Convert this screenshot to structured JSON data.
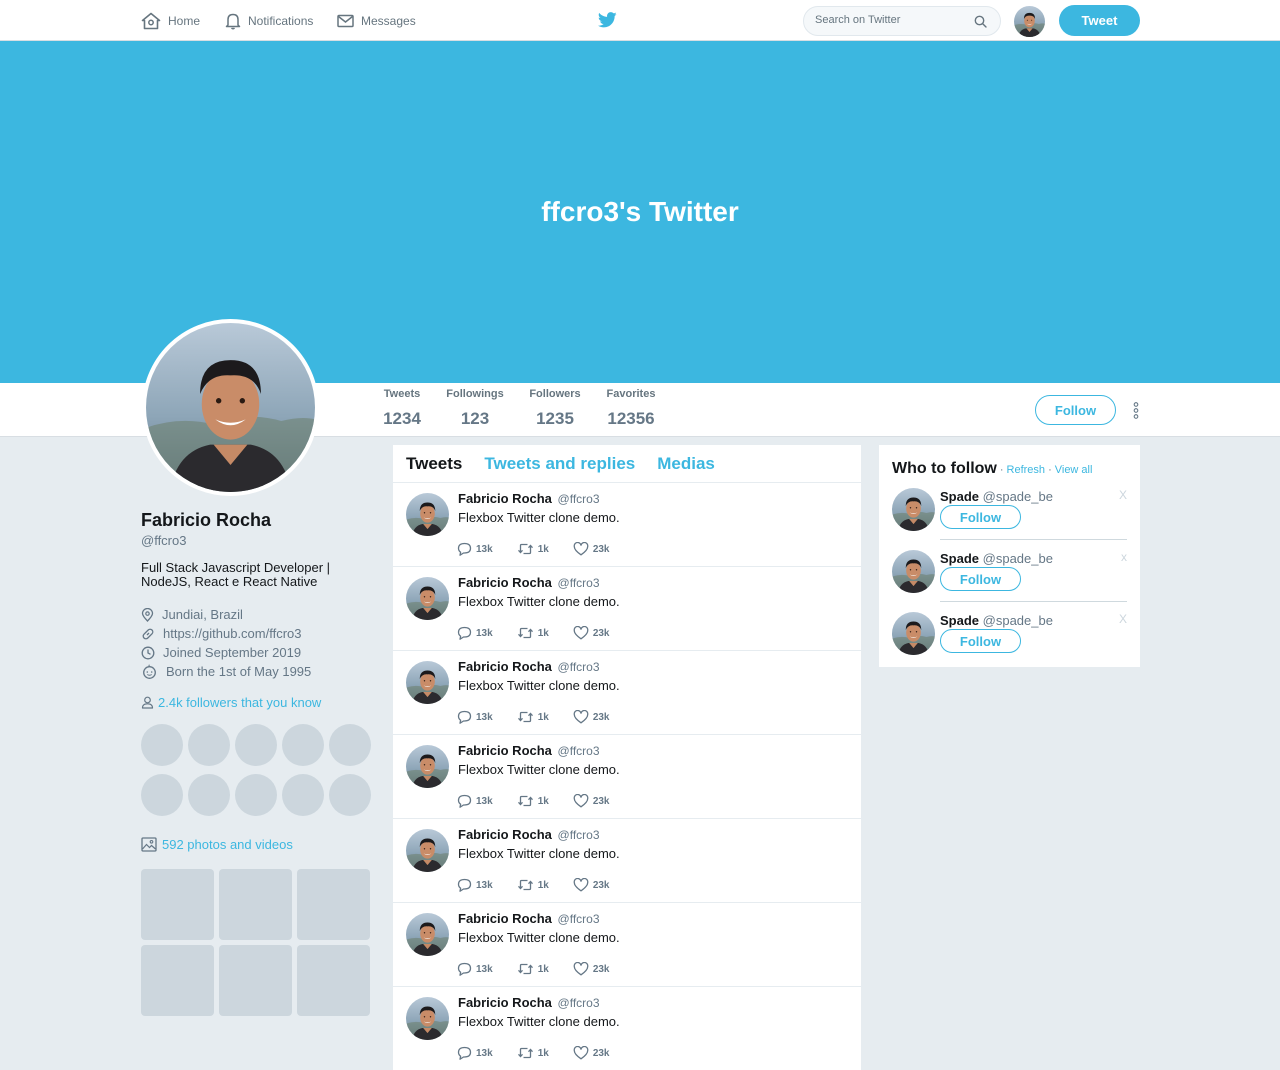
{
  "nav": {
    "items": [
      {
        "label": "Home",
        "icon": "home-icon"
      },
      {
        "label": "Notifications",
        "icon": "bell-icon"
      },
      {
        "label": "Messages",
        "icon": "envelope-icon"
      }
    ],
    "logo_icon": "twitter-bird-icon",
    "search_placeholder": "Search on Twitter",
    "tweet_button": "Tweet"
  },
  "banner": {
    "title": "ffcro3's Twitter"
  },
  "stats": [
    {
      "label": "Tweets",
      "value": "1234"
    },
    {
      "label": "Followings",
      "value": "123"
    },
    {
      "label": "Followers",
      "value": "1235"
    },
    {
      "label": "Favorites",
      "value": "12356"
    }
  ],
  "follow_button": "Follow",
  "profile": {
    "name": "Fabricio Rocha",
    "handle": "@ffcro3",
    "bio": "Full Stack Javascript Developer | NodeJS, React e React Native",
    "location": "Jundiai, Brazil",
    "website": "https://github.com/ffcro3",
    "joined": "Joined September 2019",
    "birthday": "Born the 1st of May 1995",
    "followers_you_know": "2.4k followers that you know",
    "photos_videos": "592 photos and videos"
  },
  "tabs": [
    "Tweets",
    "Tweets and replies",
    "Medias"
  ],
  "tweets": [
    {
      "name": "Fabricio Rocha",
      "handle": "@ffcro3",
      "text": "Flexbox Twitter clone demo.",
      "replies": "13k",
      "retweets": "1k",
      "likes": "23k"
    },
    {
      "name": "Fabricio Rocha",
      "handle": "@ffcro3",
      "text": "Flexbox Twitter clone demo.",
      "replies": "13k",
      "retweets": "1k",
      "likes": "23k"
    },
    {
      "name": "Fabricio Rocha",
      "handle": "@ffcro3",
      "text": "Flexbox Twitter clone demo.",
      "replies": "13k",
      "retweets": "1k",
      "likes": "23k"
    },
    {
      "name": "Fabricio Rocha",
      "handle": "@ffcro3",
      "text": "Flexbox Twitter clone demo.",
      "replies": "13k",
      "retweets": "1k",
      "likes": "23k"
    },
    {
      "name": "Fabricio Rocha",
      "handle": "@ffcro3",
      "text": "Flexbox Twitter clone demo.",
      "replies": "13k",
      "retweets": "1k",
      "likes": "23k"
    },
    {
      "name": "Fabricio Rocha",
      "handle": "@ffcro3",
      "text": "Flexbox Twitter clone demo.",
      "replies": "13k",
      "retweets": "1k",
      "likes": "23k"
    },
    {
      "name": "Fabricio Rocha",
      "handle": "@ffcro3",
      "text": "Flexbox Twitter clone demo.",
      "replies": "13k",
      "retweets": "1k",
      "likes": "23k"
    }
  ],
  "who_to_follow": {
    "title": "Who to follow",
    "separator": "·",
    "refresh": "Refresh",
    "view_all": "View all",
    "suggestions": [
      {
        "name": "Spade",
        "handle": "@spade_be",
        "button": "Follow",
        "close": "X"
      },
      {
        "name": "Spade",
        "handle": "@spade_be",
        "button": "Follow",
        "close": "x"
      },
      {
        "name": "Spade",
        "handle": "@spade_be",
        "button": "Follow",
        "close": "X"
      }
    ]
  },
  "colors": {
    "accent": "#3cb7e0",
    "background": "#e6ecf0",
    "placeholder": "#ccd6dd",
    "text_muted": "#657786"
  }
}
